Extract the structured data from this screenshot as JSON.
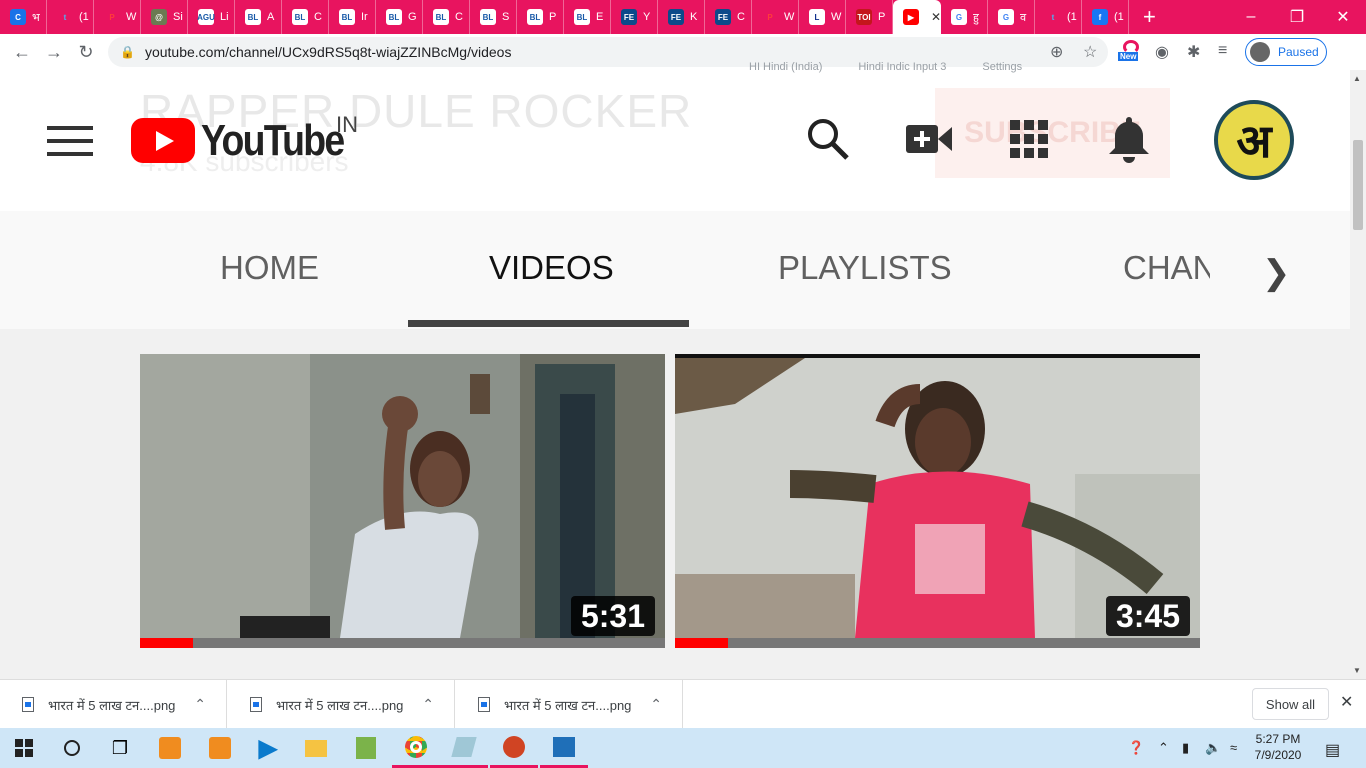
{
  "browser": {
    "tabs": [
      {
        "favicon": "C",
        "title": "भ",
        "fav_bg": "#1a73e8",
        "fav_fg": "#fff"
      },
      {
        "favicon": "t",
        "title": "(1",
        "fav_bg": "#e8145f",
        "fav_fg": "#4ab3f4"
      },
      {
        "favicon": "P",
        "title": "W",
        "fav_bg": "#e8145f",
        "fav_fg": "#ff3b3b"
      },
      {
        "favicon": "@",
        "title": "Si",
        "fav_bg": "#6b7a52",
        "fav_fg": "#fff"
      },
      {
        "favicon": "AGU",
        "title": "Li",
        "fav_bg": "#ffffff",
        "fav_fg": "#1a5aa8"
      },
      {
        "favicon": "BL",
        "title": "A",
        "fav_bg": "#ffffff",
        "fav_fg": "#1a5aa8"
      },
      {
        "favicon": "BL",
        "title": "C",
        "fav_bg": "#ffffff",
        "fav_fg": "#1a5aa8"
      },
      {
        "favicon": "BL",
        "title": "Ir",
        "fav_bg": "#ffffff",
        "fav_fg": "#1a5aa8"
      },
      {
        "favicon": "BL",
        "title": "G",
        "fav_bg": "#ffffff",
        "fav_fg": "#1a5aa8"
      },
      {
        "favicon": "BL",
        "title": "C",
        "fav_bg": "#ffffff",
        "fav_fg": "#1a5aa8"
      },
      {
        "favicon": "BL",
        "title": "S",
        "fav_bg": "#ffffff",
        "fav_fg": "#1a5aa8"
      },
      {
        "favicon": "BL",
        "title": "P",
        "fav_bg": "#ffffff",
        "fav_fg": "#1a5aa8"
      },
      {
        "favicon": "BL",
        "title": "E",
        "fav_bg": "#ffffff",
        "fav_fg": "#1a5aa8"
      },
      {
        "favicon": "FE",
        "title": "Y",
        "fav_bg": "#0d4a8a",
        "fav_fg": "#fff"
      },
      {
        "favicon": "FE",
        "title": "K",
        "fav_bg": "#0d4a8a",
        "fav_fg": "#fff"
      },
      {
        "favicon": "FE",
        "title": "C",
        "fav_bg": "#0d4a8a",
        "fav_fg": "#fff"
      },
      {
        "favicon": "P",
        "title": "W",
        "fav_bg": "#e8145f",
        "fav_fg": "#ff3b3b"
      },
      {
        "favicon": "L",
        "title": "W",
        "fav_bg": "#ffffff",
        "fav_fg": "#0a2a8a"
      },
      {
        "favicon": "TOI",
        "title": "P",
        "fav_bg": "#c4161c",
        "fav_fg": "#fff"
      },
      {
        "favicon": "▶",
        "title": "",
        "fav_bg": "#ff0000",
        "fav_fg": "#fff",
        "active": true
      },
      {
        "favicon": "G",
        "title": "हु",
        "fav_bg": "#ffffff",
        "fav_fg": "#4285f4"
      },
      {
        "favicon": "G",
        "title": "व",
        "fav_bg": "#ffffff",
        "fav_fg": "#4285f4"
      },
      {
        "favicon": "t",
        "title": "(1",
        "fav_bg": "#e8145f",
        "fav_fg": "#4ab3f4"
      },
      {
        "favicon": "f",
        "title": "(1",
        "fav_bg": "#1877f2",
        "fav_fg": "#fff"
      }
    ],
    "url": "youtube.com/channel/UCx9dRS5q8t-wiajZZINBcMg/videos",
    "profile_label": "Paused",
    "new_badge": "New",
    "ime": {
      "language": "HI Hindi (India)",
      "input_tool": "Hindi Indic Input 3",
      "settings": "Settings"
    }
  },
  "youtube": {
    "logo_text": "YouTube",
    "country": "IN",
    "ghost_channel_name": "RAPPER DULE ROCKER",
    "ghost_subscribers": "4.8K subscribers",
    "ghost_subscribe": "SUBSCRIBE",
    "avatar_letter": "अ",
    "channel_tabs": [
      "HOME",
      "VIDEOS",
      "PLAYLISTS",
      "CHANNELS"
    ],
    "selected_tab": "VIDEOS",
    "videos": [
      {
        "duration": "5:31",
        "watched_fraction": 0.1
      },
      {
        "duration": "3:45",
        "watched_fraction": 0.1
      }
    ]
  },
  "downloads": {
    "items": [
      {
        "name": "भारत में 5 लाख टन....png"
      },
      {
        "name": "भारत में 5 लाख टन....png"
      },
      {
        "name": "भारत में 5 लाख टन....png"
      }
    ],
    "show_all": "Show all"
  },
  "taskbar": {
    "time": "5:27 PM",
    "date": "7/9/2020"
  }
}
